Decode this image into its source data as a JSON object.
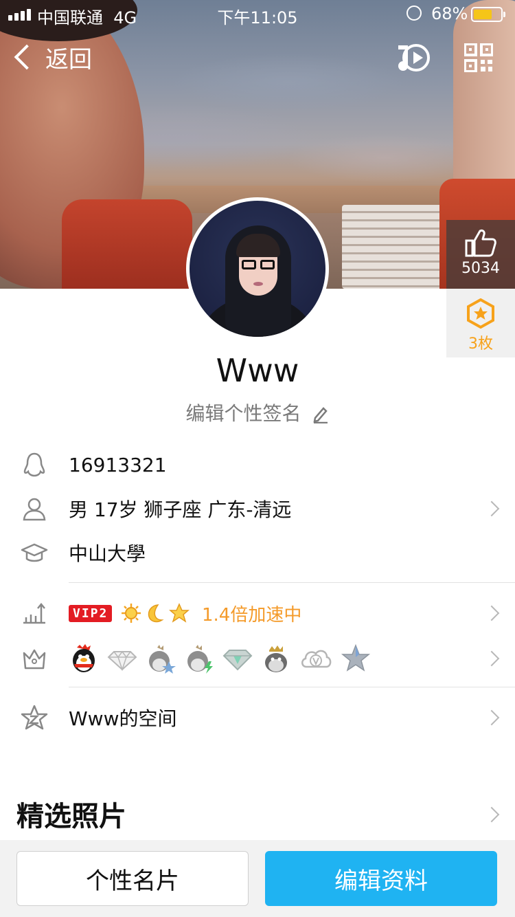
{
  "status_bar": {
    "carrier": "中国联通",
    "network": "4G",
    "time": "下午11:05",
    "battery_percent": "68%",
    "battery_level": 0.68,
    "battery_color": "#f5c518"
  },
  "nav": {
    "back_label": "返回",
    "icons": [
      "music-play-icon",
      "qr-code-icon"
    ]
  },
  "likes": {
    "count": "5034",
    "icon": "thumbs-up-icon"
  },
  "medals": {
    "count": "3枚",
    "icon": "star-medal-icon",
    "color": "#f7a21b"
  },
  "profile": {
    "name": "Www",
    "signature": "编辑个性签名"
  },
  "info": {
    "qq_number": "16913321",
    "personal": "男 17岁 狮子座 广东-清远",
    "school": "中山大學"
  },
  "vip": {
    "badge": "VIP2",
    "level_icons": [
      "sun-icon",
      "moon-icon",
      "star-icon"
    ],
    "speed_text": "1.4倍加速中",
    "speed_color": "#f49a29"
  },
  "service_badges": [
    "qq-penguin-icon",
    "diamond-icon",
    "penguin-star-icon",
    "penguin-bolt-icon",
    "green-diamond-icon",
    "crown-penguin-icon",
    "cloud-v-icon",
    "gray-star-icon"
  ],
  "qzone": {
    "label": "Www的空间"
  },
  "photos": {
    "title": "精选照片"
  },
  "buttons": {
    "card": "个性名片",
    "edit": "编辑资料",
    "edit_color": "#1fb3f2"
  }
}
